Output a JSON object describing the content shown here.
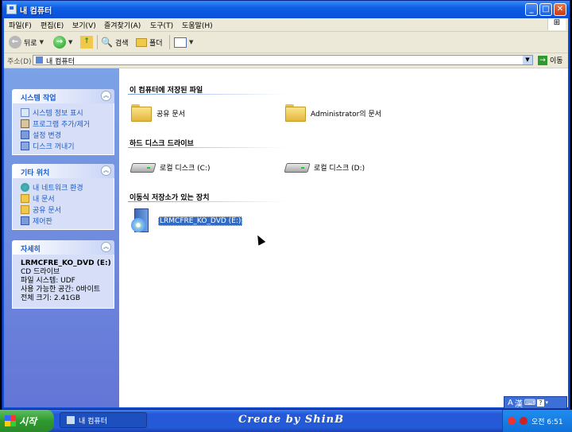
{
  "window": {
    "title": "내 컴퓨터"
  },
  "menu": [
    "파일(F)",
    "편집(E)",
    "보기(V)",
    "즐겨찾기(A)",
    "도구(T)",
    "도움말(H)"
  ],
  "toolbar": {
    "back": "뒤로",
    "search": "검색",
    "folders": "폴더"
  },
  "address": {
    "label": "주소(D)",
    "value": "내 컴퓨터",
    "go": "이동"
  },
  "tasks": {
    "title": "시스템 작업",
    "items": [
      "시스템 정보 표시",
      "프로그램 추가/제거",
      "설정 변경",
      "디스크 꺼내기"
    ]
  },
  "places": {
    "title": "기타 위치",
    "items": [
      "내 네트워크 환경",
      "내 문서",
      "공유 문서",
      "제어판"
    ]
  },
  "details": {
    "title": "자세히",
    "name": "LRMCFRE_KO_DVD (E:)",
    "type": "CD 드라이브",
    "fs": "파일 시스템: UDF",
    "free": "사용 가능한 공간: 0바이트",
    "total": "전체 크기: 2.41GB"
  },
  "groups": {
    "stored": "이 컴퓨터에 저장된 파일",
    "hdd": "하드 디스크 드라이브",
    "removable": "이동식 저장소가 있는 장치"
  },
  "files": {
    "shared": "공유 문서",
    "admin": "Administrator의 문서"
  },
  "drives": {
    "c": "로컬 디스크 (C:)",
    "d": "로컬 디스크 (D:)",
    "e": "LRMCFRE_KO_DVD (E:)"
  },
  "langbar": {
    "mode": "A",
    "hanja": "漢"
  },
  "taskbar": {
    "start": "시작",
    "task": "내 컴퓨터",
    "credit": "Create by ShinB",
    "clock": "오전 6:51"
  }
}
